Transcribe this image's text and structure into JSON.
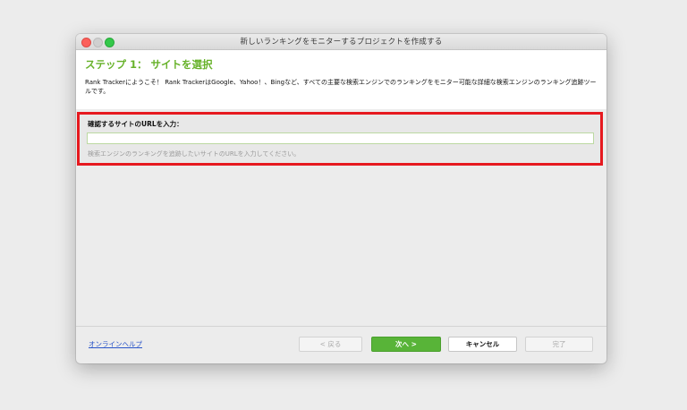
{
  "window": {
    "title": "新しいランキングをモニターするプロジェクトを作成する"
  },
  "header": {
    "step_title": "ステップ 1： サイトを選択",
    "description": "Rank Trackerにようこそ！ Rank TrackerはGoogle、Yahoo！、Bingなど、すべての主要な検索エンジンでのランキングをモニター可能な詳細な検索エンジンのランキング追跡ツールです。"
  },
  "url_section": {
    "label": "確認するサイトのURLを入力：",
    "value": "",
    "hint": "検索エンジンのランキングを追跡したいサイトのURLを入力してください。",
    "highlight_color": "#e6191f"
  },
  "footer": {
    "help_link": "オンラインヘルプ",
    "back_label": "< 戻る",
    "next_label": "次へ >",
    "cancel_label": "キャンセル",
    "finish_label": "完了"
  },
  "colors": {
    "accent_green": "#67b22a",
    "next_button": "#58b438",
    "link_blue": "#2a55c9"
  }
}
